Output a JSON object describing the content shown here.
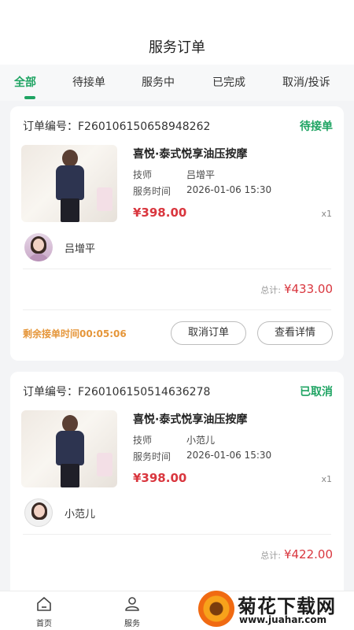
{
  "header": {
    "title": "服务订单"
  },
  "tabs": [
    {
      "label": "全部",
      "active": true
    },
    {
      "label": "待接单",
      "active": false
    },
    {
      "label": "服务中",
      "active": false
    },
    {
      "label": "已完成",
      "active": false
    },
    {
      "label": "取消/投诉",
      "active": false
    }
  ],
  "orders": [
    {
      "order_no": "订单编号：F260106150658948262",
      "status": "待接单",
      "service_title": "喜悦·泰式悦享油压按摩",
      "technician_label": "技师",
      "technician_value": "吕增平",
      "time_label": "服务时间",
      "time_value": "2026-01-06 15:30",
      "price": "¥398.00",
      "qty": "x1",
      "tech_name": "吕增平",
      "total_label": "总计:",
      "total_value": "¥433.00",
      "countdown": "剩余接单时间00:05:06",
      "buttons": {
        "cancel": "取消订单",
        "detail": "查看详情"
      }
    },
    {
      "order_no": "订单编号：F260106150514636278",
      "status": "已取消",
      "service_title": "喜悦·泰式悦享油压按摩",
      "technician_label": "技师",
      "technician_value": "小范儿",
      "time_label": "服务时间",
      "time_value": "2026-01-06 15:30",
      "price": "¥398.00",
      "qty": "x1",
      "tech_name": "小范儿",
      "total_label": "总计:",
      "total_value": "¥422.00"
    }
  ],
  "bottom_nav": [
    {
      "label": "首页",
      "icon": "home-icon"
    },
    {
      "label": "服务",
      "icon": "service-icon"
    }
  ],
  "watermark": {
    "text": "菊花下载网",
    "url": "www.juahar.com"
  },
  "colors": {
    "accent": "#1fa463",
    "price": "#d9363e",
    "countdown": "#e5963a"
  }
}
